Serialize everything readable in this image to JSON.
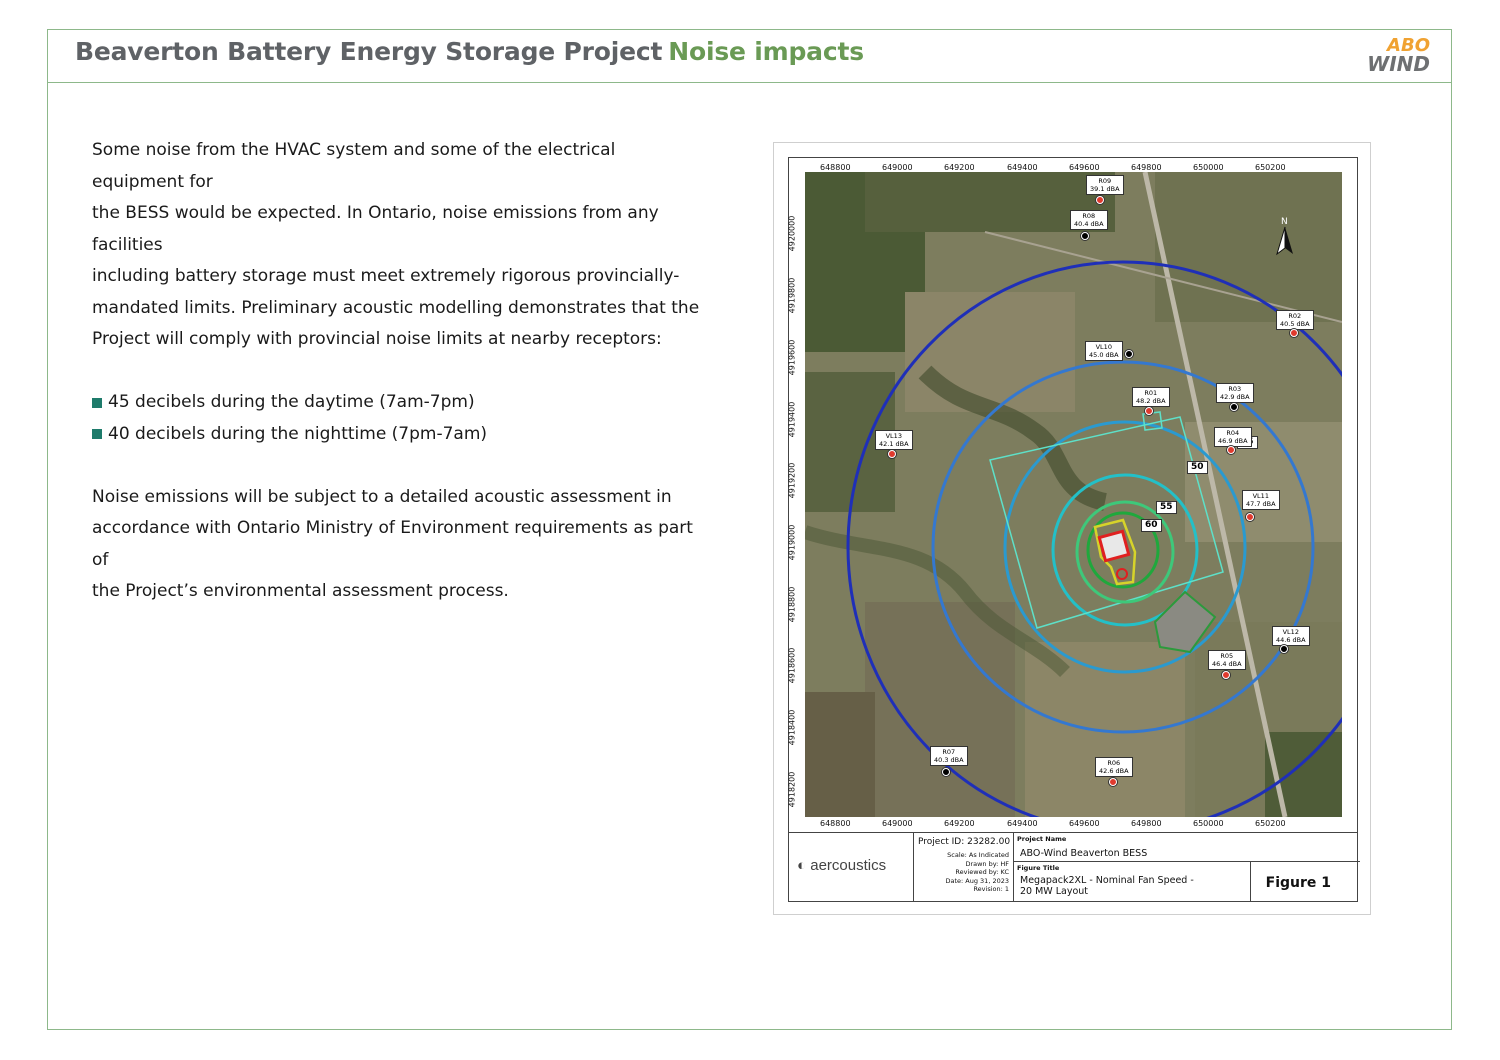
{
  "header": {
    "title": "Beaverton Battery Energy Storage Project",
    "subtitle": "Noise impacts",
    "logo_line1": "ABO",
    "logo_line2": "WIND",
    "colors": {
      "border": "#8db88a",
      "title": "#5f6266",
      "subtitle": "#6a9a55",
      "logo_orange": "#f0a232",
      "logo_gray": "#6e7072"
    }
  },
  "body": {
    "paragraph1_lines": [
      "Some noise from the HVAC system and some of the electrical equipment for",
      "the BESS would be expected. In Ontario, noise emissions from any facilities",
      "including battery storage must meet extremely rigorous provincially-",
      "mandated limits. Preliminary acoustic modelling demonstrates that the",
      "Project will comply with provincial noise limits at nearby receptors:"
    ],
    "bullets": [
      "45 decibels during the daytime (7am-7pm)",
      "40 decibels during the nighttime (7pm-7am)"
    ],
    "paragraph2_lines": [
      "Noise emissions will be subject to a detailed acoustic assessment in",
      "accordance with Ontario Ministry of Environment requirements as part of",
      "the Project’s environmental assessment process."
    ],
    "bullet_color": "#1e7b6b"
  },
  "figure": {
    "x_ticks": [
      "648800",
      "649000",
      "649200",
      "649400",
      "649600",
      "649800",
      "650000",
      "650200"
    ],
    "y_ticks": [
      "4920000",
      "4919800",
      "4919600",
      "4919400",
      "4919200",
      "4919000",
      "4918800",
      "4918600",
      "4918400",
      "4918200"
    ],
    "contour_labels": [
      "45",
      "50",
      "55",
      "60"
    ],
    "receptors": [
      {
        "id": "R09",
        "level": "39.1 dBA",
        "type": "red"
      },
      {
        "id": "R08",
        "level": "40.4 dBA",
        "type": "red"
      },
      {
        "id": "R02",
        "level": "40.5 dBA",
        "type": "red"
      },
      {
        "id": "VL10",
        "level": "45.0 dBA",
        "type": "black"
      },
      {
        "id": "R01",
        "level": "48.2 dBA",
        "type": "red"
      },
      {
        "id": "R03",
        "level": "42.9 dBA",
        "type": "black"
      },
      {
        "id": "R04",
        "level": "46.9 dBA",
        "type": "red"
      },
      {
        "id": "VL13",
        "level": "42.1 dBA",
        "type": "red"
      },
      {
        "id": "VL11",
        "level": "47.7 dBA",
        "type": "red"
      },
      {
        "id": "VL12",
        "level": "44.6 dBA",
        "type": "black"
      },
      {
        "id": "R05",
        "level": "46.4 dBA",
        "type": "red"
      },
      {
        "id": "R07",
        "level": "40.3 dBA",
        "type": "black"
      },
      {
        "id": "R06",
        "level": "42.6 dBA",
        "type": "red"
      }
    ],
    "north": "N",
    "titleblock": {
      "company": "aercoustics",
      "project_id": "Project ID: 23282.00",
      "meta": [
        "Scale: As Indicated",
        "Drawn by: HF",
        "Reviewed by: KC",
        "Date: Aug 31, 2023",
        "Revision: 1"
      ],
      "project_name_label": "Project Name",
      "project_name": "ABO-Wind Beaverton BESS",
      "figure_title_label": "Figure Title",
      "figure_title_line1": "Megapack2XL - Nominal Fan Speed -",
      "figure_title_line2": "20 MW Layout",
      "figure_number": "Figure 1"
    }
  }
}
